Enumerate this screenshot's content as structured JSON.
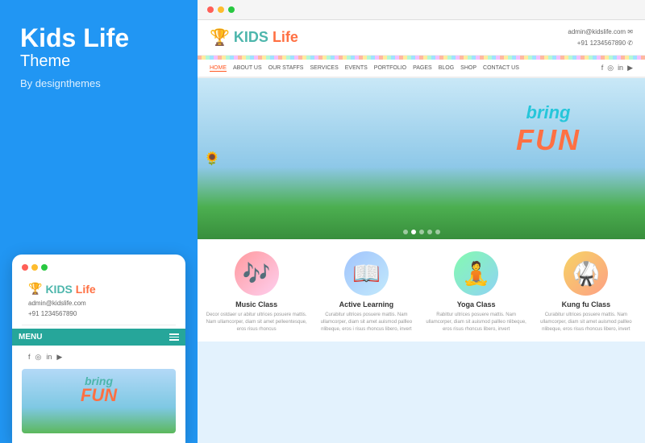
{
  "left": {
    "title": "Kids Life",
    "subtitle": "Theme",
    "by": "By designthemes"
  },
  "mobile": {
    "logo_kids": "KIDS",
    "logo_life": "Life",
    "email": "admin@kidslife.com",
    "phone": "+91 1234567890",
    "menu_label": "MENU",
    "bring": "bring",
    "fun": "FUN"
  },
  "browser": {
    "dots": [
      "red",
      "yellow",
      "green"
    ]
  },
  "site": {
    "logo_kids": "KIDS",
    "logo_life": "Life",
    "email": "admin@kidslife.com ✉",
    "phone": "+91 1234567890 ✆",
    "nav": [
      {
        "label": "HOME",
        "active": true
      },
      {
        "label": "ABOUT US",
        "active": false
      },
      {
        "label": "OUR STAFFS",
        "active": false
      },
      {
        "label": "SERVICES",
        "active": false
      },
      {
        "label": "EVENTS",
        "active": false
      },
      {
        "label": "PORTFOLIO",
        "active": false
      },
      {
        "label": "PAGES",
        "active": false
      },
      {
        "label": "BLOG",
        "active": false
      },
      {
        "label": "SHOP",
        "active": false
      },
      {
        "label": "CONTACT US",
        "active": false
      }
    ],
    "hero": {
      "bring": "bring",
      "fun": "FUN"
    },
    "classes": [
      {
        "name": "Music Class",
        "emoji": "🎵",
        "desc": "Decor ostdaer ur abitur ultrices posuere mattis. Nam ullamcorper, diam sit amet pelleentesque, eros risus rhoncus"
      },
      {
        "name": "Active Learning",
        "emoji": "📚",
        "desc": "Curabitur ultrices posuere mattis. Nam ullamcorper, diam sit amet auismod pallleo nlibeque, eros i risus rhoncus libero, invert"
      },
      {
        "name": "Yoga Class",
        "emoji": "🧘",
        "desc": "Rabittur ultrices posuere mattis. Nam ullamcorper, diam sit auismod pallleo nlibeque, eros risus rhoncus libero, invert"
      },
      {
        "name": "Kung fu Class",
        "emoji": "🥋",
        "desc": "Curabitur ultrices posuere mattis. Nam ullamcorper, diam sit amet auismod pallleo nlibeque, eros risus rhoncus libero, invert"
      }
    ]
  },
  "colors": {
    "blue": "#2196F3",
    "teal": "#26a69a",
    "orange": "#ff7043",
    "red": "#ff5f57",
    "yellow": "#febc2e",
    "green": "#28c840"
  }
}
